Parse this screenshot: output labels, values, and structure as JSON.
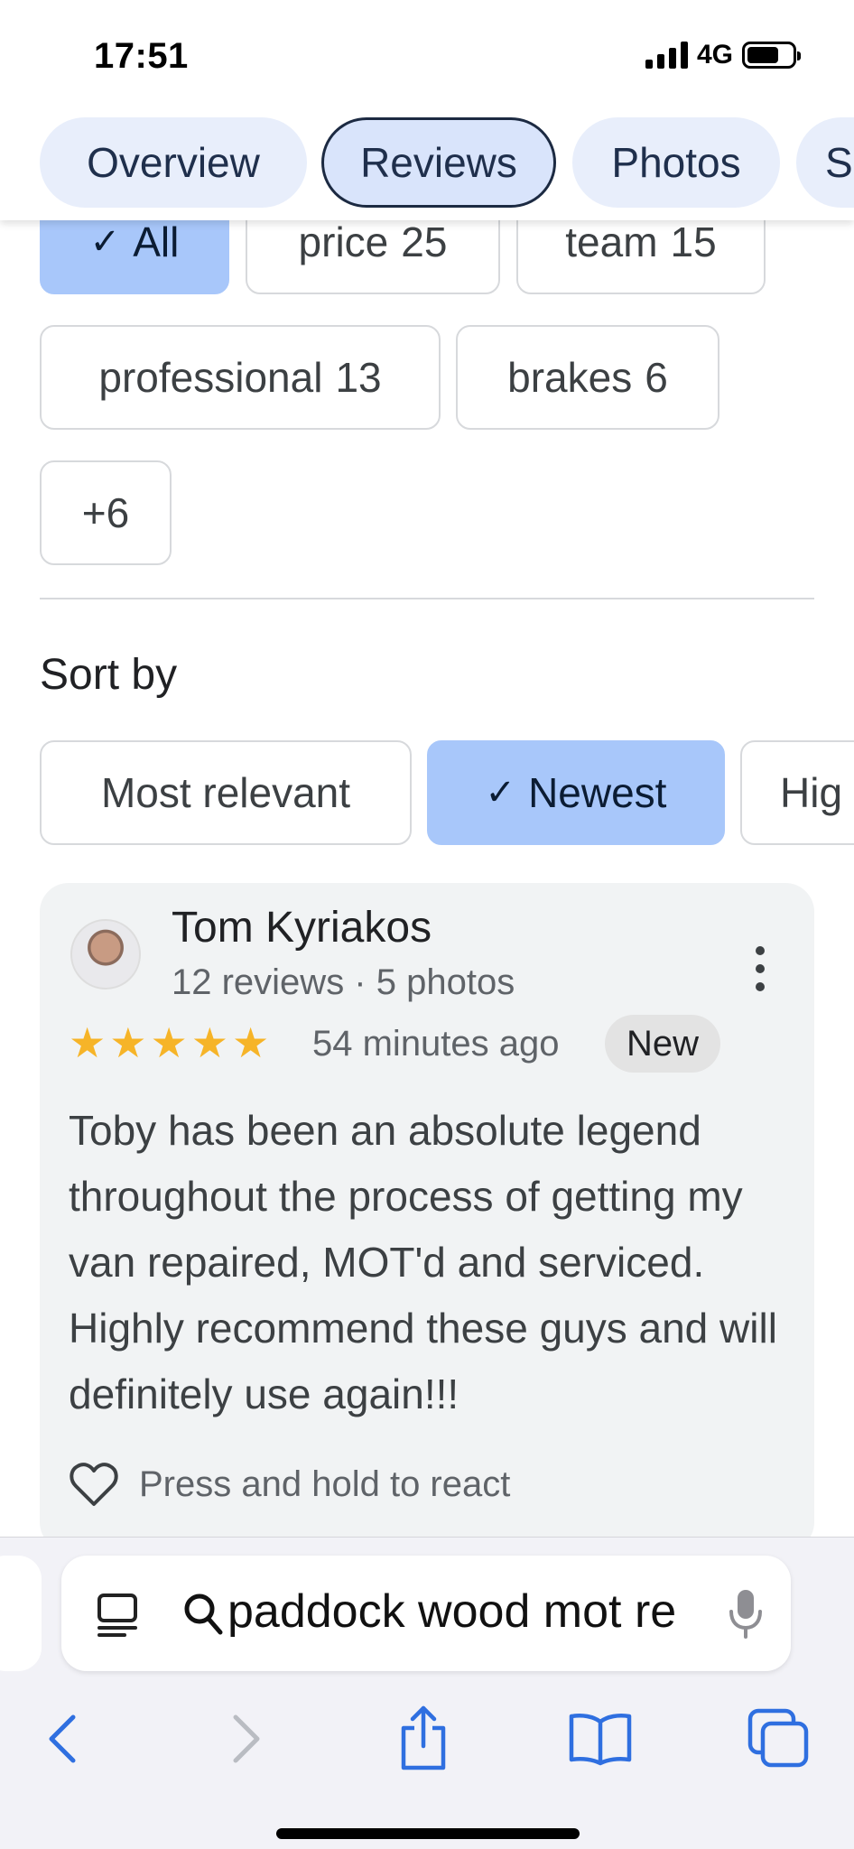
{
  "status_bar": {
    "time": "17:51",
    "network": "4G",
    "battery_level": 0.7
  },
  "tabs": [
    {
      "label": "Overview",
      "active": false
    },
    {
      "label": "Reviews",
      "active": true
    },
    {
      "label": "Photos",
      "active": false
    },
    {
      "label": "S",
      "active": false
    }
  ],
  "topic_chips": [
    {
      "label": "All",
      "count": "",
      "selected": true
    },
    {
      "label": "price",
      "count": "25",
      "selected": false
    },
    {
      "label": "team",
      "count": "15",
      "selected": false
    },
    {
      "label": "professional",
      "count": "13",
      "selected": false
    },
    {
      "label": "brakes",
      "count": "6",
      "selected": false
    },
    {
      "label": "+6",
      "count": "",
      "selected": false
    }
  ],
  "sort": {
    "label": "Sort by",
    "options": [
      {
        "label": "Most relevant",
        "selected": false
      },
      {
        "label": "Newest",
        "selected": true
      },
      {
        "label": "Hig",
        "selected": false
      }
    ]
  },
  "review": {
    "name": "Tom Kyriakos",
    "meta": "12 reviews · 5 photos",
    "rating": 5,
    "time": "54 minutes ago",
    "badge": "New",
    "text": "Toby has been an absolute legend throughout the process of getting my van repaired, MOT'd and serviced. Highly recommend these guys and will definitely use again!!!",
    "react_label": "Press and hold to react"
  },
  "browser": {
    "address_text": "paddock wood mot re"
  },
  "colors": {
    "accent": "#a8c7fa",
    "star": "#f6b428",
    "link_blue": "#2f6fe0"
  },
  "icons": [
    "check-icon",
    "more-vert-icon",
    "star-icon",
    "heart-icon",
    "page-menu-icon",
    "search-icon",
    "mic-icon",
    "back-icon",
    "forward-icon",
    "share-icon",
    "bookmarks-icon",
    "tabs-icon"
  ]
}
